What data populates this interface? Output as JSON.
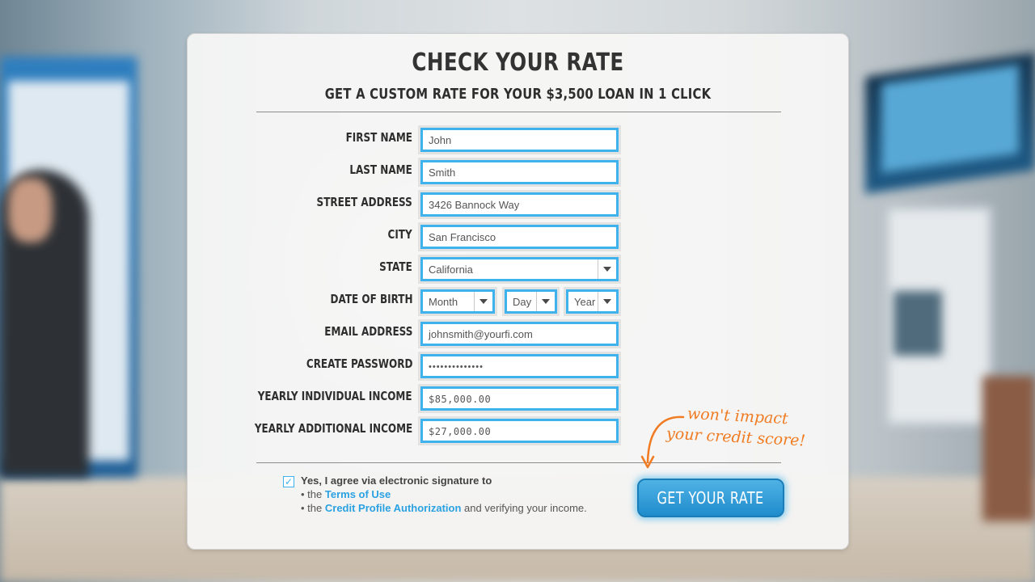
{
  "form": {
    "title": "CHECK YOUR RATE",
    "subtitle": "GET A CUSTOM RATE FOR YOUR $3,500 LOAN IN 1 CLICK",
    "fields": {
      "first_name": {
        "label": "FIRST NAME",
        "value": "John"
      },
      "last_name": {
        "label": "LAST NAME",
        "value": "Smith"
      },
      "street": {
        "label": "STREET ADDRESS",
        "value": "3426 Bannock Way"
      },
      "city": {
        "label": "CITY",
        "value": "San Francisco"
      },
      "state": {
        "label": "STATE",
        "value": "California"
      },
      "dob": {
        "label": "DATE OF BIRTH",
        "month": "Month",
        "day": "Day",
        "year": "Year"
      },
      "email": {
        "label": "EMAIL ADDRESS",
        "value": "johnsmith@yourfi.com"
      },
      "password": {
        "label": "CREATE PASSWORD",
        "value": "••••••••••••••"
      },
      "income": {
        "label": "YEARLY INDIVIDUAL INCOME",
        "value": "$85,000.00"
      },
      "additional_income": {
        "label": "YEARLY ADDITIONAL INCOME",
        "value": "$27,000.00"
      }
    },
    "agreement": {
      "checked_mark": "✓",
      "text": "Yes, I agree via electronic signature to",
      "line1_prefix": "• the",
      "line1_link": "Terms of Use",
      "line2_prefix": "• the",
      "line2_link": "Credit Profile Authorization",
      "line2_suffix": "and verifying your income."
    },
    "button": "GET YOUR RATE",
    "note_line1": "won't impact",
    "note_line2": "your credit score!"
  },
  "colors": {
    "accent": "#3eb2ec",
    "button": "#2a97d6",
    "note": "#f07b22",
    "text": "#2e2e2e"
  },
  "icons": [
    "checkbox-checked-icon",
    "dropdown-arrow-icon",
    "curved-arrow-icon"
  ]
}
